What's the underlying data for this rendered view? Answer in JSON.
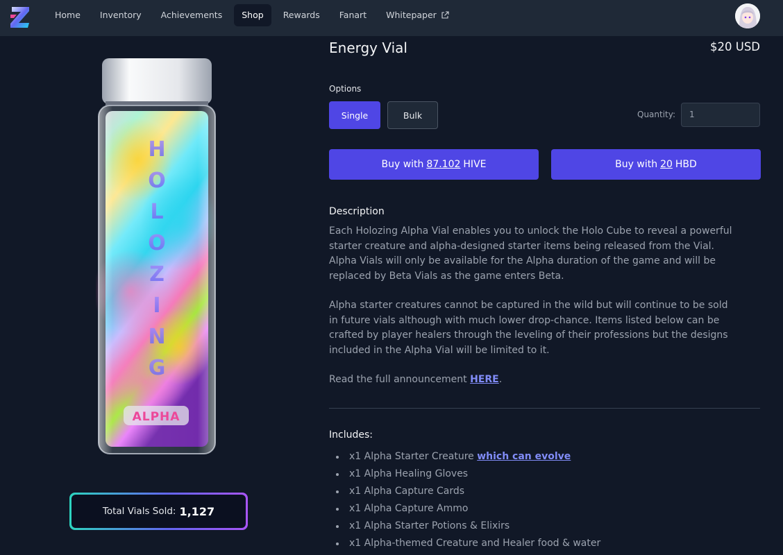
{
  "nav": {
    "items": [
      {
        "label": "Home"
      },
      {
        "label": "Inventory"
      },
      {
        "label": "Achievements"
      },
      {
        "label": "Shop"
      },
      {
        "label": "Rewards"
      },
      {
        "label": "Fanart"
      },
      {
        "label": "Whitepaper"
      }
    ],
    "active": "Shop",
    "logo_icon": "holozing-z-logo",
    "external_icon": "external-link-icon",
    "avatar_icon": "user-avatar"
  },
  "product": {
    "title": "Energy Vial",
    "price": "$20 USD",
    "vial_vertical_text": "HOLOZING",
    "vial_badge": "ALPHA"
  },
  "sold": {
    "label": "Total Vials Sold:",
    "value": "1,127"
  },
  "options": {
    "label": "Options",
    "single": "Single",
    "bulk": "Bulk",
    "quantity_label": "Quantity:",
    "quantity_value": "1"
  },
  "buy": {
    "hive_prefix": "Buy with",
    "hive_amount": "87.102",
    "hive_currency": "HIVE",
    "hbd_prefix": "Buy with",
    "hbd_amount": "20",
    "hbd_currency": "HBD"
  },
  "description": {
    "title": "Description",
    "p1": "Each Holozing Alpha Vial enables you to unlock the Holo Cube to reveal a powerful starter creature and alpha-designed starter items being released from the Vial. Alpha Vials will only be available for the Alpha duration of the game and will be replaced by Beta Vials as the game enters Beta.",
    "p2": "Alpha starter creatures cannot be captured in the wild but will continue to be sold in future vials although with much lower drop-chance. Items listed below can be crafted by player healers through the leveling of their professions but the designs included in the Alpha Vial will be limited to it.",
    "p3_prefix": "Read the full announcement",
    "p3_link": "HERE",
    "p3_suffix": "."
  },
  "includes": {
    "title": "Includes:",
    "first_prefix": "x1 Alpha Starter Creature",
    "first_link": "which can evolve",
    "items": [
      "x1 Alpha Healing Gloves",
      "x1 Alpha Capture Cards",
      "x1 Alpha Capture Ammo",
      "x1 Alpha Starter Potions & Elixirs",
      "x1 Alpha-themed Creature and Healer food & water"
    ]
  },
  "colors": {
    "background": "#111827",
    "nav": "#1f2937",
    "accent": "#4f46e5",
    "link": "#818cf8"
  }
}
